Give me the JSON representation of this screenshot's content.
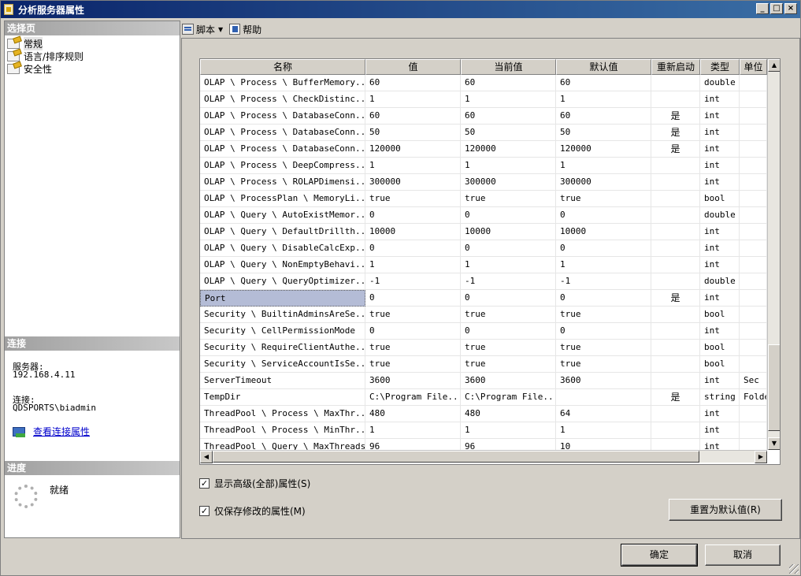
{
  "window": {
    "title": "分析服务器属性",
    "min": "_",
    "max": "□",
    "close": "×"
  },
  "left": {
    "select_page_header": "选择页",
    "pages": [
      "常规",
      "语言/排序规则",
      "安全性"
    ],
    "connection_header": "连接",
    "server_label": "服务器:",
    "server_value": "192.168.4.11",
    "connection_label": "连接:",
    "connection_value": "QDSPORTS\\biadmin",
    "view_conn_link": "查看连接属性",
    "progress_header": "进度",
    "progress_status": "就绪"
  },
  "toolbar": {
    "script_label": "脚本",
    "help_label": "帮助"
  },
  "grid": {
    "columns": [
      "名称",
      "值",
      "当前值",
      "默认值",
      "重新启动",
      "类型",
      "单位"
    ],
    "rows": [
      [
        "OLAP \\ Process \\ BufferMemory...",
        "60",
        "60",
        "60",
        "",
        "double",
        ""
      ],
      [
        "OLAP \\ Process \\ CheckDistinc...",
        "1",
        "1",
        "1",
        "",
        "int",
        ""
      ],
      [
        "OLAP \\ Process \\ DatabaseConn...",
        "60",
        "60",
        "60",
        "是",
        "int",
        ""
      ],
      [
        "OLAP \\ Process \\ DatabaseConn...",
        "50",
        "50",
        "50",
        "是",
        "int",
        ""
      ],
      [
        "OLAP \\ Process \\ DatabaseConn...",
        "120000",
        "120000",
        "120000",
        "是",
        "int",
        ""
      ],
      [
        "OLAP \\ Process \\ DeepCompress...",
        "1",
        "1",
        "1",
        "",
        "int",
        ""
      ],
      [
        "OLAP \\ Process \\ ROLAPDimensi...",
        "300000",
        "300000",
        "300000",
        "",
        "int",
        ""
      ],
      [
        "OLAP \\ ProcessPlan \\ MemoryLi...",
        "true",
        "true",
        "true",
        "",
        "bool",
        ""
      ],
      [
        "OLAP \\ Query \\ AutoExistMemor...",
        "0",
        "0",
        "0",
        "",
        "double",
        ""
      ],
      [
        "OLAP \\ Query \\ DefaultDrillth...",
        "10000",
        "10000",
        "10000",
        "",
        "int",
        ""
      ],
      [
        "OLAP \\ Query \\ DisableCalcExp...",
        "0",
        "0",
        "0",
        "",
        "int",
        ""
      ],
      [
        "OLAP \\ Query \\ NonEmptyBehavi...",
        "1",
        "1",
        "1",
        "",
        "int",
        ""
      ],
      [
        "OLAP \\ Query \\ QueryOptimizer...",
        "-1",
        "-1",
        "-1",
        "",
        "double",
        ""
      ],
      [
        "Port",
        "0",
        "0",
        "0",
        "是",
        "int",
        ""
      ],
      [
        "Security \\ BuiltinAdminsAreSe...",
        "true",
        "true",
        "true",
        "",
        "bool",
        ""
      ],
      [
        "Security \\ CellPermissionMode",
        "0",
        "0",
        "0",
        "",
        "int",
        ""
      ],
      [
        "Security \\ RequireClientAuthe...",
        "true",
        "true",
        "true",
        "",
        "bool",
        ""
      ],
      [
        "Security \\ ServiceAccountIsSe...",
        "true",
        "true",
        "true",
        "",
        "bool",
        ""
      ],
      [
        "ServerTimeout",
        "3600",
        "3600",
        "3600",
        "",
        "int",
        "Sec"
      ],
      [
        "TempDir",
        "C:\\Program File...",
        "C:\\Program File...",
        "",
        "是",
        "string",
        "Folde"
      ],
      [
        "ThreadPool \\ Process \\ MaxThr...",
        "480",
        "480",
        "64",
        "",
        "int",
        ""
      ],
      [
        "ThreadPool \\ Process \\ MinThr...",
        "1",
        "1",
        "1",
        "",
        "int",
        ""
      ],
      [
        "ThreadPool \\ Query \\ MaxThreads",
        "96",
        "96",
        "10",
        "",
        "int",
        ""
      ]
    ],
    "selected_row_label": "Port"
  },
  "options": {
    "show_advanced": "显示高级(全部)属性(S)",
    "show_advanced_checked": "✓",
    "save_modified_only": "仅保存修改的属性(M)",
    "save_modified_checked": "✓"
  },
  "buttons": {
    "reset": "重置为默认值(R)",
    "ok": "确定",
    "cancel": "取消"
  },
  "scroll_glyphs": {
    "up": "▲",
    "down": "▼",
    "left": "◀",
    "right": "▶"
  }
}
